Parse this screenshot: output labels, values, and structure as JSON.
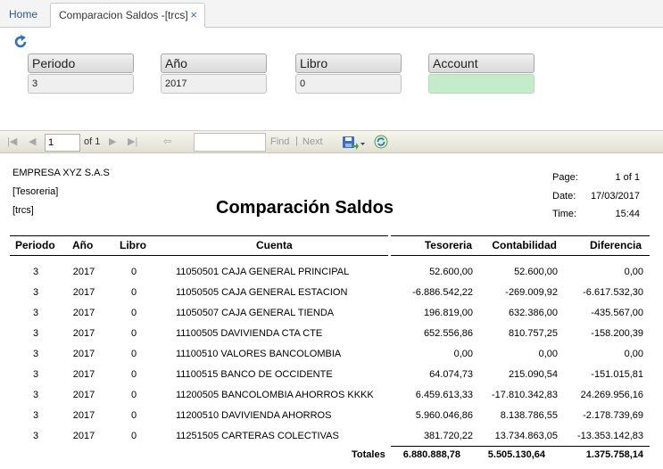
{
  "tabs": {
    "home": "Home",
    "active": "Comparacion Saldos -[trcs]",
    "close": "×"
  },
  "params": [
    {
      "label": "Periodo",
      "value": "3"
    },
    {
      "label": "Año",
      "value": "2017"
    },
    {
      "label": "Libro",
      "value": "0"
    },
    {
      "label": "Account",
      "value": ""
    }
  ],
  "toolbar": {
    "page": "1",
    "of": "of 1",
    "find": "Find",
    "sep": "|",
    "next": "Next"
  },
  "report": {
    "company": "EMPRESA XYZ S.A.S",
    "module": "[Tesoreria]",
    "code": "[trcs]",
    "title": "Comparación Saldos",
    "page_label": "Page:",
    "page_value": "1 of 1",
    "date_label": "Date:",
    "date_value": "17/03/2017",
    "time_label": "Time:",
    "time_value": "15:44",
    "columns": [
      "Periodo",
      "Año",
      "Libro",
      "Cuenta",
      "Tesoreria",
      "Contabilidad",
      "Diferencia"
    ],
    "rows": [
      [
        "3",
        "2017",
        "0",
        "11050501 CAJA GENERAL PRINCIPAL",
        "52.600,00",
        "52.600,00",
        "0,00"
      ],
      [
        "3",
        "2017",
        "0",
        "11050505 CAJA GENERAL ESTACION",
        "-6.886.542,22",
        "-269.009,92",
        "-6.617.532,30"
      ],
      [
        "3",
        "2017",
        "0",
        "11050507 CAJA GENERAL TIENDA",
        "196.819,00",
        "632.386,00",
        "-435.567,00"
      ],
      [
        "3",
        "2017",
        "0",
        "11100505 DAVIVIENDA CTA CTE",
        "652.556,86",
        "810.757,25",
        "-158.200,39"
      ],
      [
        "3",
        "2017",
        "0",
        "11100510 VALORES BANCOLOMBIA",
        "0,00",
        "0,00",
        "0,00"
      ],
      [
        "3",
        "2017",
        "0",
        "11100515 BANCO DE OCCIDENTE",
        "64.074,73",
        "215.090,54",
        "-151.015,81"
      ],
      [
        "3",
        "2017",
        "0",
        "11200505 BANCOLOMBIA AHORROS KKKK",
        "6.459.613,33",
        "-17.810.342,83",
        "24.269.956,16"
      ],
      [
        "3",
        "2017",
        "0",
        "11200510 DAVIVIENDA AHORROS",
        "5.960.046,86",
        "8.138.786,55",
        "-2.178.739,69"
      ],
      [
        "3",
        "2017",
        "0",
        "11251505 CARTERAS COLECTIVAS",
        "381.720,22",
        "13.734.863,05",
        "-13.353.142,83"
      ]
    ],
    "totals_label": "Totales",
    "totals": [
      "6.880.888,78",
      "5.505.130,64",
      "1.375.758,14"
    ]
  },
  "colors": {
    "accent": "#2c5a8c",
    "account_field": "#c5ecc8"
  }
}
